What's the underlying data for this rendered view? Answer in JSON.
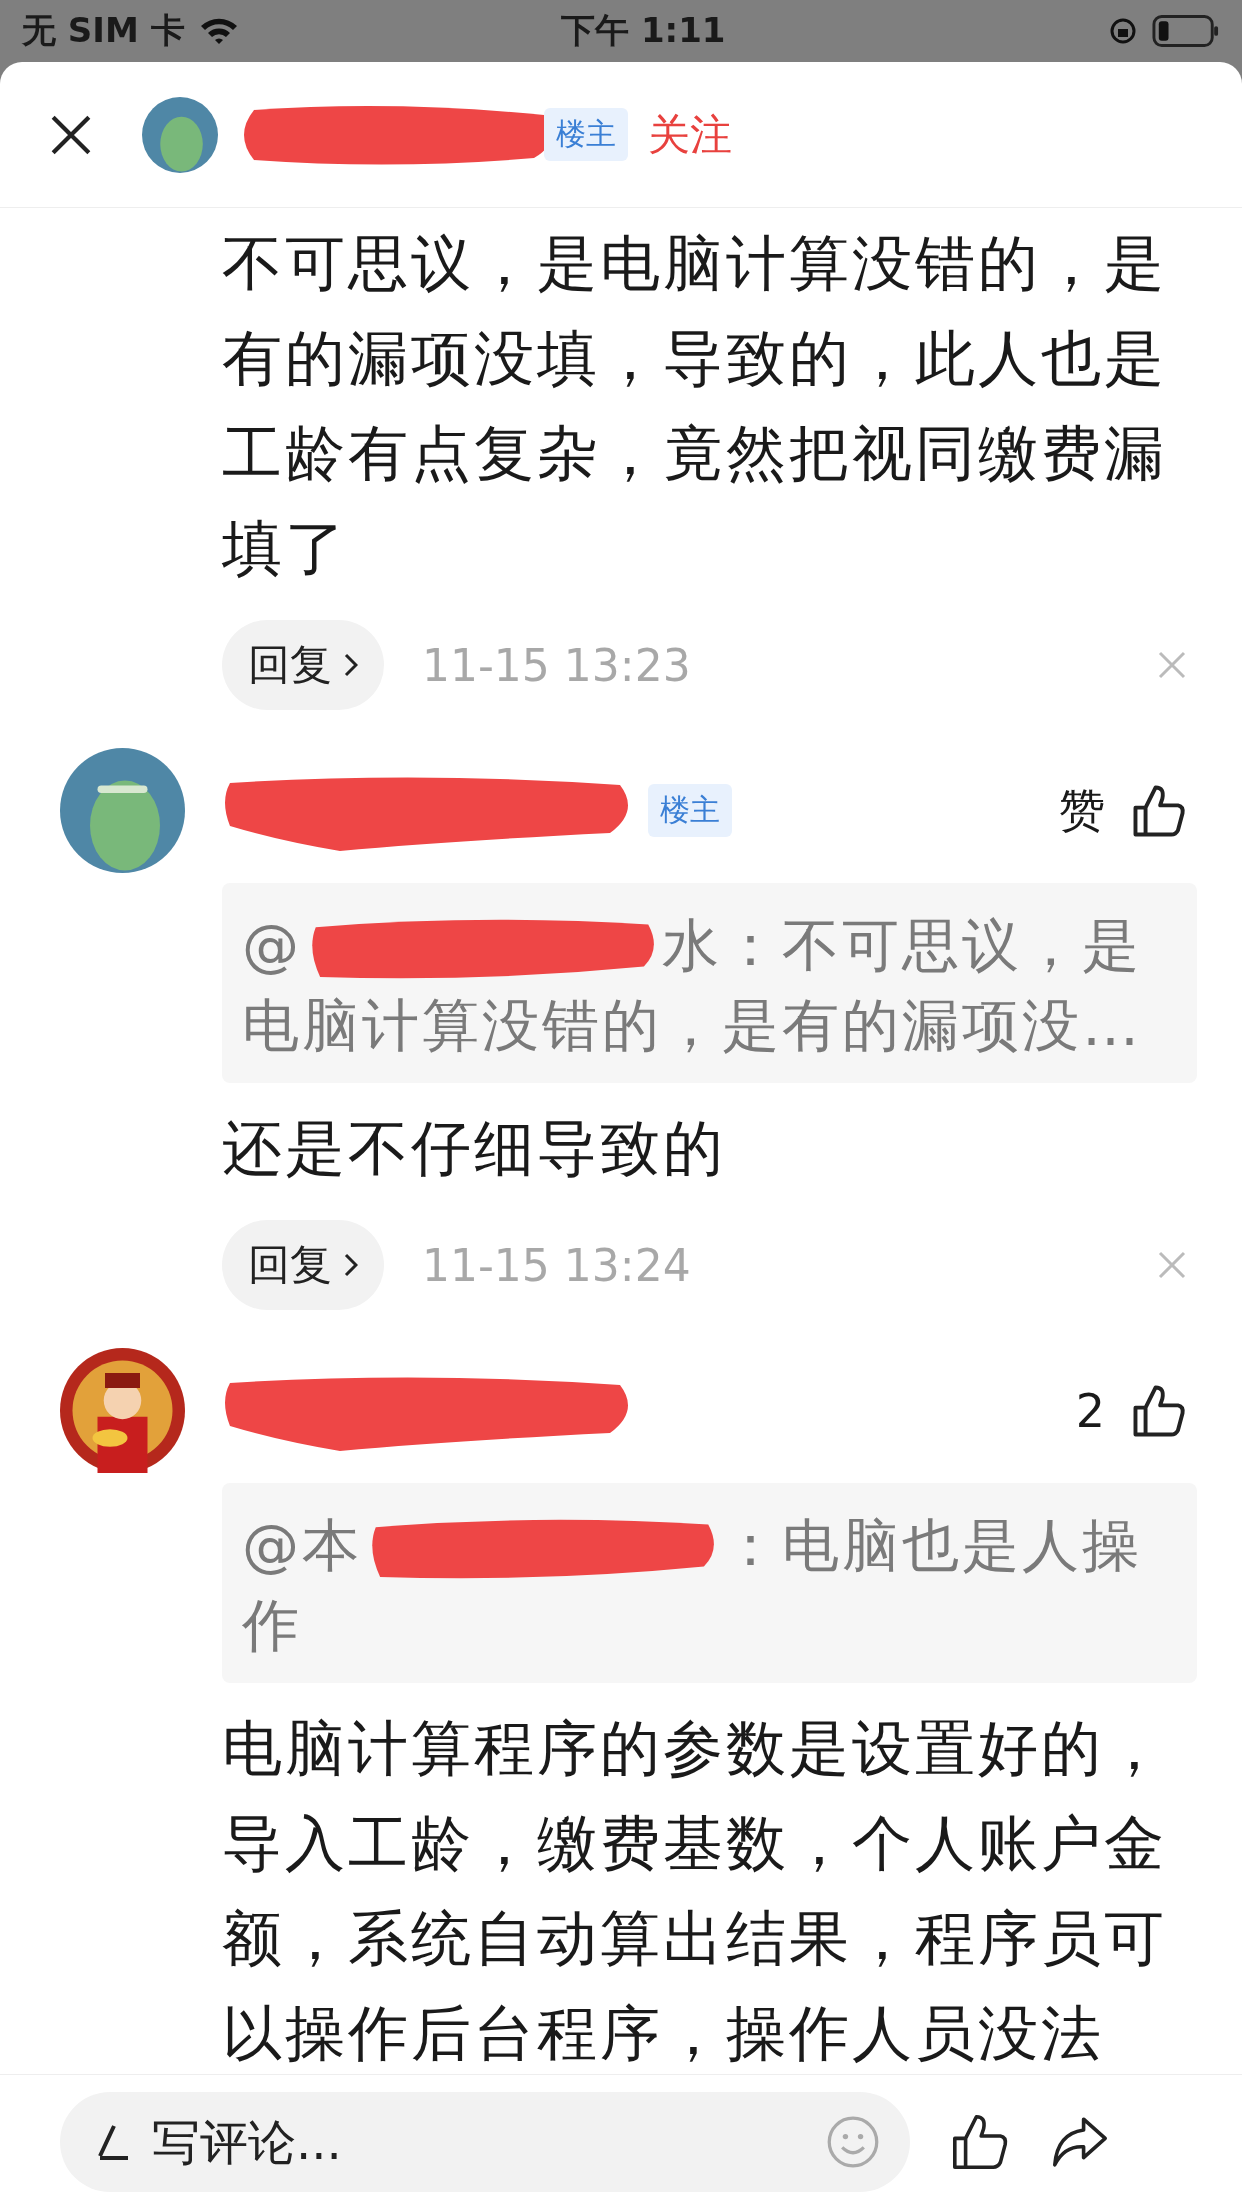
{
  "status_bar": {
    "carrier": "无 SIM 卡",
    "time": "下午 1:11"
  },
  "header": {
    "badge": "楼主",
    "follow": "关注"
  },
  "comments": [
    {
      "kind": "continuation",
      "text": "不可思议，是电脑计算没错的，是有的漏项没填，导致的，此人也是工龄有点复杂，竟然把视同缴费漏填了",
      "reply": "回复",
      "time": "11-15 13:23"
    },
    {
      "kind": "full",
      "badge": "楼主",
      "like": "赞",
      "quote": {
        "prefix": "@",
        "text": "水：不可思议，是电脑计算没错的，是有的漏项没…"
      },
      "text": "还是不仔细导致的",
      "reply": "回复",
      "time": "11-15 13:24"
    },
    {
      "kind": "full",
      "like": "2",
      "quote": {
        "prefix": "@本",
        "text": "：电脑也是人操作"
      },
      "text": "电脑计算程序的参数是设置好的，导入工龄，缴费基数，个人账户金额，系统自动算出结果，程序员可以操作后台程序，操作人员没法"
    }
  ],
  "composer": {
    "placeholder": "写评论..."
  }
}
